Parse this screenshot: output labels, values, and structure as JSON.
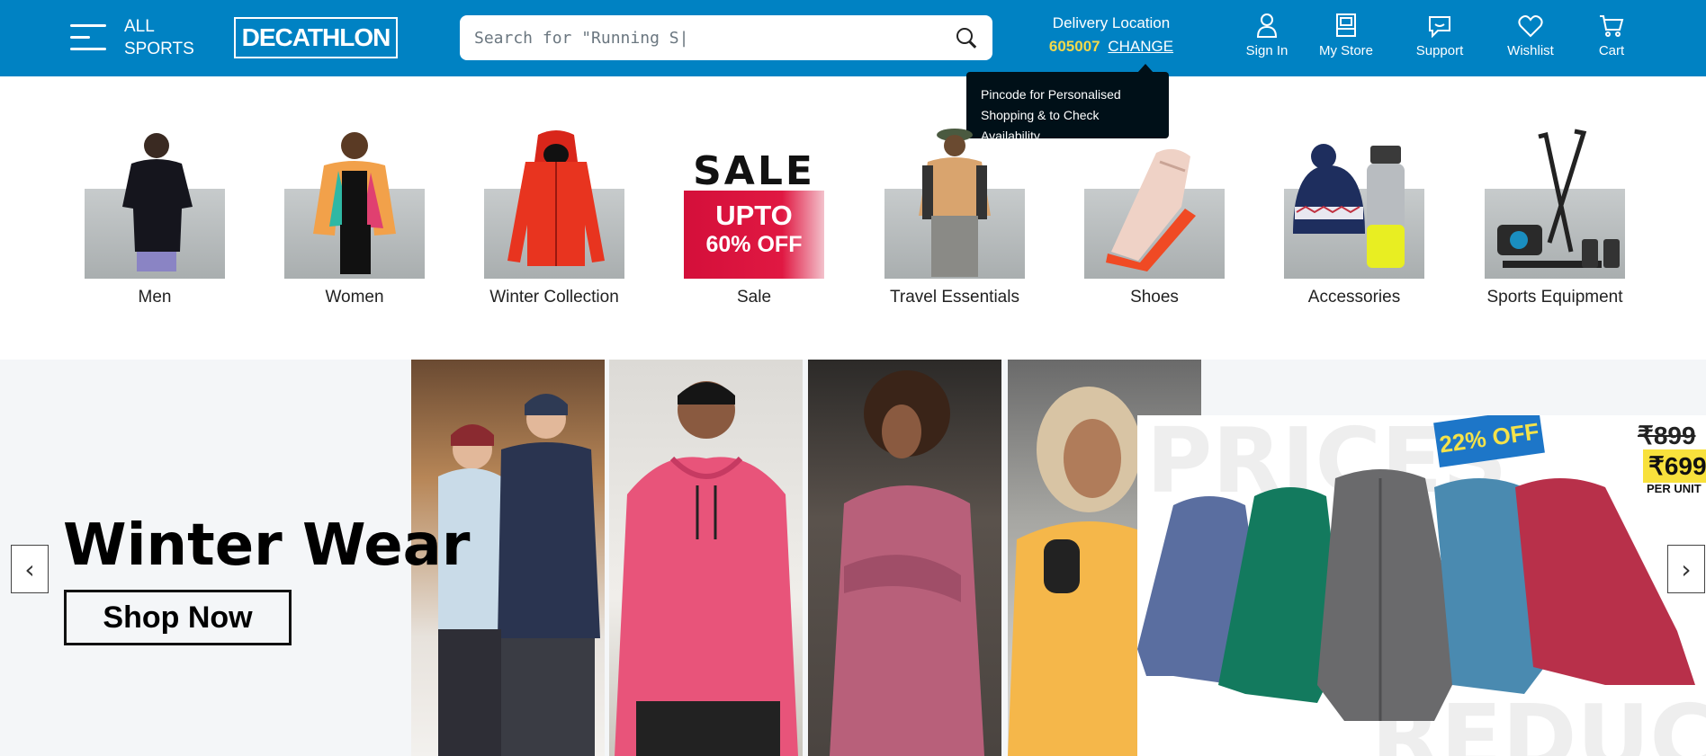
{
  "header": {
    "all_sports_line1": "ALL",
    "all_sports_line2": "SPORTS",
    "logo": "DECATHLON",
    "search_placeholder": "Search for \"Running S|",
    "delivery_title": "Delivery Location",
    "pincode": "605007",
    "change_label": "CHANGE",
    "nav": [
      {
        "label": "Sign In",
        "icon": "user-icon"
      },
      {
        "label": "My Store",
        "icon": "store-icon"
      },
      {
        "label": "Support",
        "icon": "support-icon"
      },
      {
        "label": "Wishlist",
        "icon": "heart-icon"
      },
      {
        "label": "Cart",
        "icon": "cart-icon"
      }
    ],
    "colors": {
      "brand": "#0082c3",
      "pincode": "#f4d94a"
    }
  },
  "tooltip": {
    "line1": "Pincode for Personalised",
    "line2": "Shopping & to Check Availability"
  },
  "categories": [
    {
      "label": "Men"
    },
    {
      "label": "Women"
    },
    {
      "label": "Winter Collection"
    },
    {
      "label": "Sale",
      "sale_word": "SALE",
      "sale_upto": "UPTO",
      "sale_off": "60% OFF"
    },
    {
      "label": "Travel Essentials"
    },
    {
      "label": "Shoes"
    },
    {
      "label": "Accessories"
    },
    {
      "label": "Sports Equipment"
    }
  ],
  "banner": {
    "title": "Winter Wear",
    "cta": "Shop Now",
    "discount": "22% OFF",
    "price_old": "₹899",
    "price_new": "₹699",
    "per_unit": "PER UNIT",
    "bg_word_top": "PRICES",
    "bg_word_bottom": "REDUCED",
    "prev_arrow": "‹",
    "next_arrow": "›"
  }
}
